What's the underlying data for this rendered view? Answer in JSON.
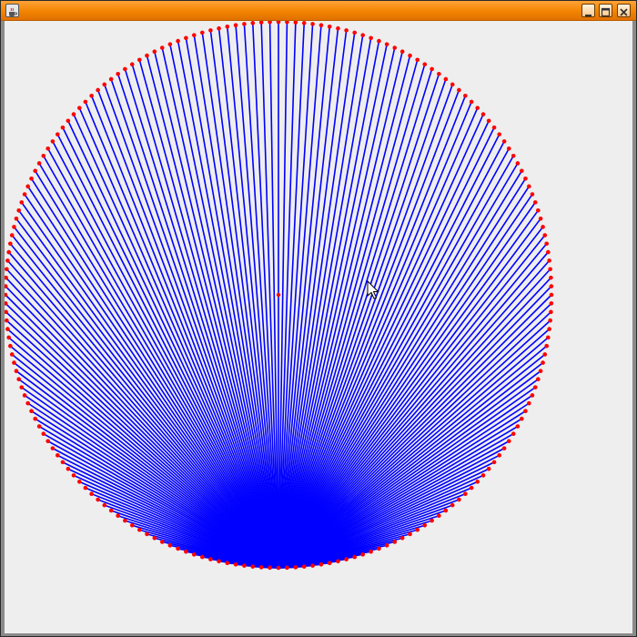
{
  "window": {
    "title": "",
    "controls": [
      {
        "name": "minimize",
        "icon": "minimize-icon"
      },
      {
        "name": "maximize",
        "icon": "maximize-icon"
      },
      {
        "name": "close",
        "icon": "close-icon"
      }
    ],
    "app_icon": "java-cup-icon"
  },
  "drawing": {
    "point_count": 200,
    "colors": {
      "titlebar": "#f28400",
      "background": "#eeeeee",
      "lines": "#0000ff",
      "points": "#ff0000",
      "center": "#ff0000"
    },
    "cursor": "arrow-cursor-icon"
  }
}
